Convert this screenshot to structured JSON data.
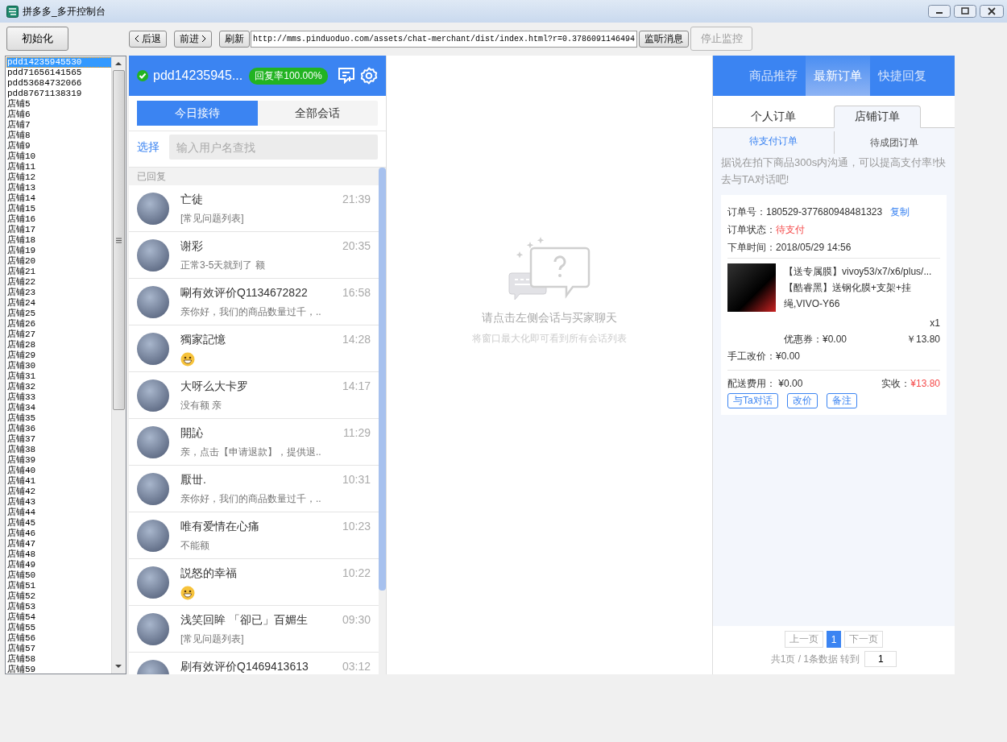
{
  "window": {
    "title": "拼多多_多开控制台"
  },
  "toolbar": {
    "init_button": "初始化",
    "back_button": "后退",
    "forward_button": "前进",
    "refresh_button": "刷新",
    "url": "http://mms.pinduoduo.com/assets/chat-merchant/dist/index.html?r=0.3786091146494",
    "listen_button": "监听消息",
    "stop_button": {
      "label": "停止监控",
      "disabled": true
    }
  },
  "shops": [
    {
      "name": "pdd14235945530",
      "selected": true
    },
    {
      "name": "pdd71656141565",
      "selected": false
    },
    {
      "name": "pdd53684732066",
      "selected": false
    },
    {
      "name": "pdd87671138319",
      "selected": false
    },
    {
      "name": "店铺5",
      "selected": false
    },
    {
      "name": "店铺6",
      "selected": false
    },
    {
      "name": "店铺7",
      "selected": false
    },
    {
      "name": "店铺8",
      "selected": false
    },
    {
      "name": "店铺9",
      "selected": false
    },
    {
      "name": "店铺10",
      "selected": false
    },
    {
      "name": "店铺11",
      "selected": false
    },
    {
      "name": "店铺12",
      "selected": false
    },
    {
      "name": "店铺13",
      "selected": false
    },
    {
      "name": "店铺14",
      "selected": false
    },
    {
      "name": "店铺15",
      "selected": false
    },
    {
      "name": "店铺16",
      "selected": false
    },
    {
      "name": "店铺17",
      "selected": false
    },
    {
      "name": "店铺18",
      "selected": false
    },
    {
      "name": "店铺19",
      "selected": false
    },
    {
      "name": "店铺20",
      "selected": false
    },
    {
      "name": "店铺21",
      "selected": false
    },
    {
      "name": "店铺22",
      "selected": false
    },
    {
      "name": "店铺23",
      "selected": false
    },
    {
      "name": "店铺24",
      "selected": false
    },
    {
      "name": "店铺25",
      "selected": false
    },
    {
      "name": "店铺26",
      "selected": false
    },
    {
      "name": "店铺27",
      "selected": false
    },
    {
      "name": "店铺28",
      "selected": false
    },
    {
      "name": "店铺29",
      "selected": false
    },
    {
      "name": "店铺30",
      "selected": false
    },
    {
      "name": "店铺31",
      "selected": false
    },
    {
      "name": "店铺32",
      "selected": false
    },
    {
      "name": "店铺33",
      "selected": false
    },
    {
      "name": "店铺34",
      "selected": false
    },
    {
      "name": "店铺35",
      "selected": false
    },
    {
      "name": "店铺36",
      "selected": false
    },
    {
      "name": "店铺37",
      "selected": false
    },
    {
      "name": "店铺38",
      "selected": false
    },
    {
      "name": "店铺39",
      "selected": false
    },
    {
      "name": "店铺40",
      "selected": false
    },
    {
      "name": "店铺41",
      "selected": false
    },
    {
      "name": "店铺42",
      "selected": false
    },
    {
      "name": "店铺43",
      "selected": false
    },
    {
      "name": "店铺44",
      "selected": false
    },
    {
      "name": "店铺45",
      "selected": false
    },
    {
      "name": "店铺46",
      "selected": false
    },
    {
      "name": "店铺47",
      "selected": false
    },
    {
      "name": "店铺48",
      "selected": false
    },
    {
      "name": "店铺49",
      "selected": false
    },
    {
      "name": "店铺50",
      "selected": false
    },
    {
      "name": "店铺51",
      "selected": false
    },
    {
      "name": "店铺52",
      "selected": false
    },
    {
      "name": "店铺53",
      "selected": false
    },
    {
      "name": "店铺54",
      "selected": false
    },
    {
      "name": "店铺55",
      "selected": false
    },
    {
      "name": "店铺56",
      "selected": false
    },
    {
      "name": "店铺57",
      "selected": false
    },
    {
      "name": "店铺58",
      "selected": false
    },
    {
      "name": "店铺59",
      "selected": false
    }
  ],
  "account": {
    "name": "pdd14235945...",
    "online": true,
    "reply_rate": "回复率100.00%"
  },
  "chat_tabs": [
    {
      "label": "今日接待",
      "selected": true
    },
    {
      "label": "全部会话",
      "selected": false
    }
  ],
  "select_link": "选择",
  "search": {
    "placeholder": "输入用户名查找"
  },
  "section": "已回复",
  "conversations": [
    {
      "name": "亡徒",
      "time": "21:39",
      "kind": "text",
      "preview": "[常见问题列表]"
    },
    {
      "name": "谢彩",
      "time": "20:35",
      "kind": "text",
      "preview": "正常3-5天就到了 额"
    },
    {
      "name": "唰有效评价Q1134672822",
      "time": "16:58",
      "kind": "text",
      "preview": "亲你好，我们的商品数量过千，.."
    },
    {
      "name": "獨家記憶",
      "time": "14:28",
      "kind": "emoji"
    },
    {
      "name": "大呀么大卡罗",
      "time": "14:17",
      "kind": "text",
      "preview": "没有额 亲"
    },
    {
      "name": "開訫",
      "time": "11:29",
      "kind": "text",
      "preview": "亲，点击【申请退款】，提供退.."
    },
    {
      "name": "厭丗.",
      "time": "10:31",
      "kind": "text",
      "preview": "亲你好，我们的商品数量过千，.."
    },
    {
      "name": "唯有爱情在心痛",
      "time": "10:23",
      "kind": "text",
      "preview": "不能额"
    },
    {
      "name": "説怒的幸福",
      "time": "10:22",
      "kind": "emoji"
    },
    {
      "name": "浅笑回眸 「卻已」百媚生",
      "time": "09:30",
      "kind": "text",
      "preview": "[常见问题列表]"
    },
    {
      "name": "刷有效评价Q1469413613",
      "time": "03:12",
      "kind": "none"
    }
  ],
  "empty_state": {
    "title": "请点击左侧会话与买家聊天",
    "hint": "将窗口最大化即可看到所有会话列表"
  },
  "side_tabs": [
    {
      "label": "商品推荐",
      "selected": false
    },
    {
      "label": "最新订单",
      "selected": true
    },
    {
      "label": "快捷回复",
      "selected": false
    }
  ],
  "order_tabs": [
    {
      "label": "个人订单",
      "selected": false
    },
    {
      "label": "店铺订单",
      "selected": true
    }
  ],
  "order_subtabs": [
    {
      "label": "待支付订单",
      "selected": true
    },
    {
      "label": "待成团订单",
      "selected": false
    }
  ],
  "tip": "据说在拍下商品300s内沟通，可以提高支付率!快去与TA对话吧!",
  "order": {
    "number_label": "订单号：",
    "number": "180529-377680948481323",
    "copy_link": "复制",
    "status_label": "订单状态：",
    "status": "待支付",
    "time_label": "下单时间：",
    "time": "2018/05/29 14:56",
    "product_title": "【送专属膜】vivoy53/x7/x6/plus/...",
    "product_variant": "【酷睿黑】送钢化膜+支架+挂绳,VIVO-Y66",
    "quantity": "x1",
    "coupon": "优惠券：¥0.00",
    "price": "￥13.80",
    "manual_price": "手工改价：¥0.00",
    "shipping": "配送费用： ¥0.00",
    "received_label": "实收：",
    "received": "¥13.80",
    "actions": [
      "与Ta对话",
      "改价",
      "备注"
    ]
  },
  "pagination": {
    "prev": "上一页",
    "pages": [
      {
        "label": "1",
        "selected": true
      }
    ],
    "next": "下一页",
    "summary": "共1页 / 1条数据 转到",
    "goto": "1"
  }
}
